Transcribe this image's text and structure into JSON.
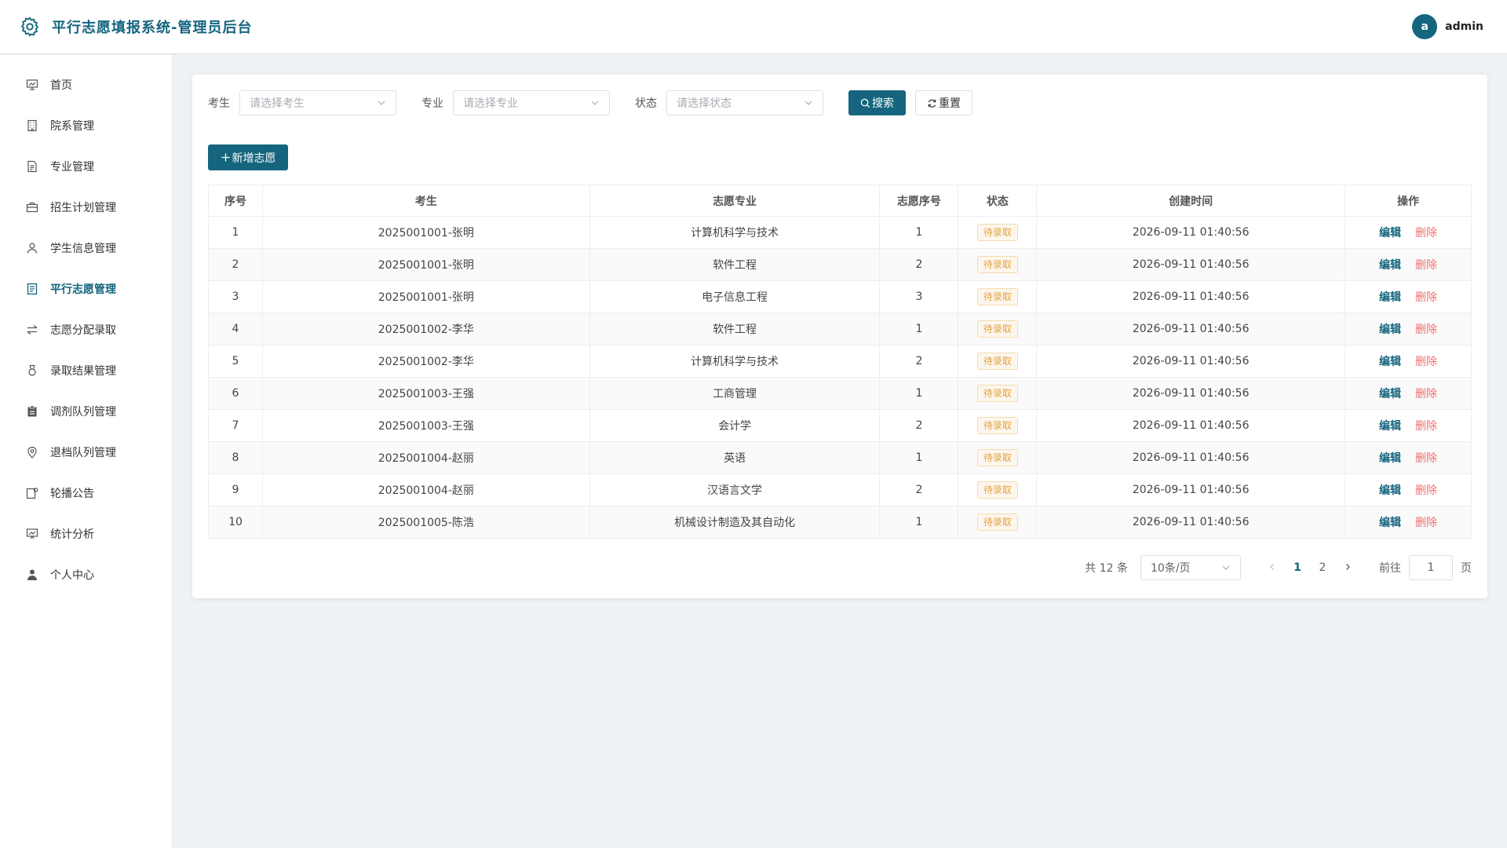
{
  "header": {
    "title": "平行志愿填报系统-管理员后台",
    "avatar_letter": "a",
    "username": "admin"
  },
  "sidebar": {
    "items": [
      {
        "label": "首页",
        "icon": "home-chart-icon"
      },
      {
        "label": "院系管理",
        "icon": "building-icon"
      },
      {
        "label": "专业管理",
        "icon": "document-icon"
      },
      {
        "label": "招生计划管理",
        "icon": "briefcase-icon"
      },
      {
        "label": "学生信息管理",
        "icon": "user-outline-icon"
      },
      {
        "label": "平行志愿管理",
        "icon": "list-doc-icon"
      },
      {
        "label": "志愿分配录取",
        "icon": "switch-icon"
      },
      {
        "label": "录取结果管理",
        "icon": "medal-icon"
      },
      {
        "label": "调剂队列管理",
        "icon": "clipboard-icon"
      },
      {
        "label": "退档队列管理",
        "icon": "location-icon"
      },
      {
        "label": "轮播公告",
        "icon": "notice-icon"
      },
      {
        "label": "统计分析",
        "icon": "chart-icon"
      },
      {
        "label": "个人中心",
        "icon": "user-filled-icon"
      }
    ],
    "active_index": 5
  },
  "filters": {
    "student_label": "考生",
    "student_placeholder": "请选择考生",
    "major_label": "专业",
    "major_placeholder": "请选择专业",
    "status_label": "状态",
    "status_placeholder": "请选择状态",
    "search_label": "搜索",
    "reset_label": "重置"
  },
  "add_button_label": "新增志愿",
  "table": {
    "columns": [
      "序号",
      "考生",
      "志愿专业",
      "志愿序号",
      "状态",
      "创建时间",
      "操作"
    ],
    "rows": [
      {
        "no": "1",
        "student": "2025001001-张明",
        "major": "计算机科学与技术",
        "order": "1",
        "status": "待录取",
        "created": "2026-09-11 01:40:56"
      },
      {
        "no": "2",
        "student": "2025001001-张明",
        "major": "软件工程",
        "order": "2",
        "status": "待录取",
        "created": "2026-09-11 01:40:56"
      },
      {
        "no": "3",
        "student": "2025001001-张明",
        "major": "电子信息工程",
        "order": "3",
        "status": "待录取",
        "created": "2026-09-11 01:40:56"
      },
      {
        "no": "4",
        "student": "2025001002-李华",
        "major": "软件工程",
        "order": "1",
        "status": "待录取",
        "created": "2026-09-11 01:40:56"
      },
      {
        "no": "5",
        "student": "2025001002-李华",
        "major": "计算机科学与技术",
        "order": "2",
        "status": "待录取",
        "created": "2026-09-11 01:40:56"
      },
      {
        "no": "6",
        "student": "2025001003-王强",
        "major": "工商管理",
        "order": "1",
        "status": "待录取",
        "created": "2026-09-11 01:40:56"
      },
      {
        "no": "7",
        "student": "2025001003-王强",
        "major": "会计学",
        "order": "2",
        "status": "待录取",
        "created": "2026-09-11 01:40:56"
      },
      {
        "no": "8",
        "student": "2025001004-赵丽",
        "major": "英语",
        "order": "1",
        "status": "待录取",
        "created": "2026-09-11 01:40:56"
      },
      {
        "no": "9",
        "student": "2025001004-赵丽",
        "major": "汉语言文学",
        "order": "2",
        "status": "待录取",
        "created": "2026-09-11 01:40:56"
      },
      {
        "no": "10",
        "student": "2025001005-陈浩",
        "major": "机械设计制造及其自动化",
        "order": "1",
        "status": "待录取",
        "created": "2026-09-11 01:40:56"
      }
    ],
    "edit_label": "编辑",
    "delete_label": "删除"
  },
  "pagination": {
    "total_text": "共 12 条",
    "page_size": "10条/页",
    "pages": [
      "1",
      "2"
    ],
    "current_page": "1",
    "goto_label": "前往",
    "goto_value": "1",
    "page_suffix": "页"
  },
  "colors": {
    "primary": "#15657e",
    "danger": "#f56c6c",
    "warning": "#e6a23c"
  }
}
